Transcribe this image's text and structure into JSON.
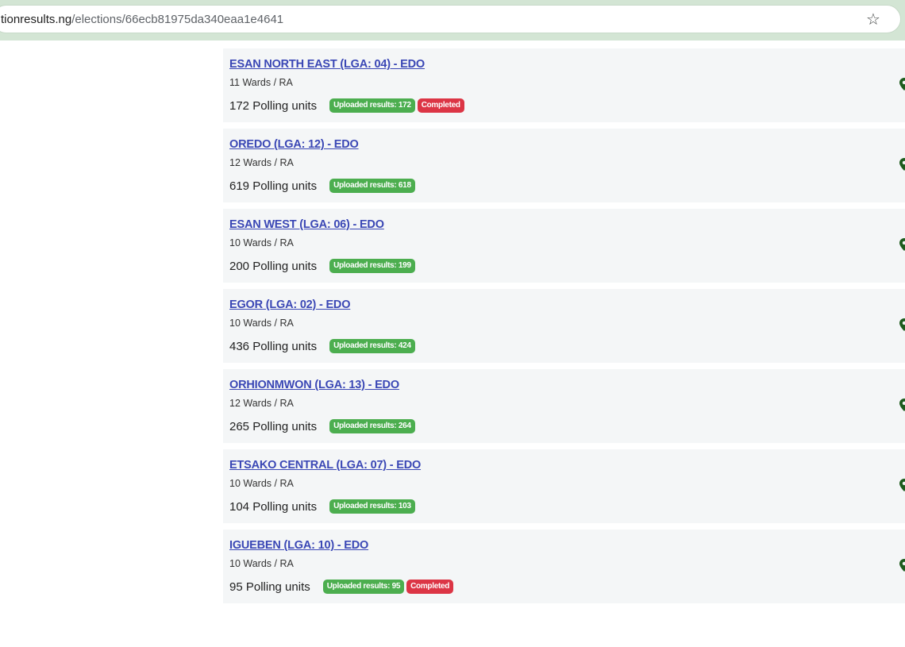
{
  "browser": {
    "url_host": "tionresults.ng",
    "url_path": "/elections/66ecb81975da340eaa1e4641",
    "star_icon": "bookmark-star-icon"
  },
  "colors": {
    "link": "#3a47b5",
    "uploaded_badge": "#4cae4f",
    "completed_badge": "#dc3545",
    "pin": "#1e5c1e",
    "card_bg": "#f4f6f7",
    "browser_bar": "#d3e5d4"
  },
  "lgas": [
    {
      "title": "ESAN NORTH EAST (LGA: 04) - EDO",
      "wards": "11 Wards / RA",
      "polling_units": "172 Polling units",
      "uploaded": "Uploaded results: 172",
      "completed": "Completed"
    },
    {
      "title": "OREDO (LGA: 12) - EDO",
      "wards": "12 Wards / RA",
      "polling_units": "619 Polling units",
      "uploaded": "Uploaded results: 618",
      "completed": null
    },
    {
      "title": "ESAN WEST (LGA: 06) - EDO",
      "wards": "10 Wards / RA",
      "polling_units": "200 Polling units",
      "uploaded": "Uploaded results: 199",
      "completed": null
    },
    {
      "title": "EGOR (LGA: 02) - EDO",
      "wards": "10 Wards / RA",
      "polling_units": "436 Polling units",
      "uploaded": "Uploaded results: 424",
      "completed": null
    },
    {
      "title": "ORHIONMWON (LGA: 13) - EDO",
      "wards": "12 Wards / RA",
      "polling_units": "265 Polling units",
      "uploaded": "Uploaded results: 264",
      "completed": null
    },
    {
      "title": "ETSAKO CENTRAL (LGA: 07) - EDO",
      "wards": "10 Wards / RA",
      "polling_units": "104 Polling units",
      "uploaded": "Uploaded results: 103",
      "completed": null
    },
    {
      "title": "IGUEBEN (LGA: 10) - EDO",
      "wards": "10 Wards / RA",
      "polling_units": "95 Polling units",
      "uploaded": "Uploaded results: 95",
      "completed": "Completed"
    }
  ]
}
